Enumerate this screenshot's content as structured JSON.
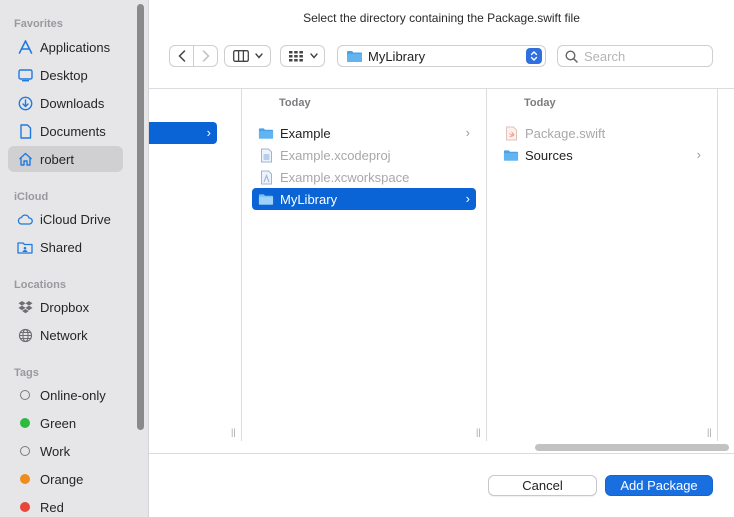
{
  "dialog": {
    "title": "Select the directory containing the Package.swift file"
  },
  "sidebar": {
    "sections": [
      {
        "heading": "Favorites",
        "items": [
          {
            "label": "Applications",
            "icon": "applications-icon"
          },
          {
            "label": "Desktop",
            "icon": "desktop-icon"
          },
          {
            "label": "Downloads",
            "icon": "downloads-icon"
          },
          {
            "label": "Documents",
            "icon": "documents-icon"
          },
          {
            "label": "robert",
            "icon": "home-icon",
            "selected": true
          }
        ]
      },
      {
        "heading": "iCloud",
        "items": [
          {
            "label": "iCloud Drive",
            "icon": "icloud-icon"
          },
          {
            "label": "Shared",
            "icon": "shared-folder-icon"
          }
        ]
      },
      {
        "heading": "Locations",
        "items": [
          {
            "label": "Dropbox",
            "icon": "dropbox-icon"
          },
          {
            "label": "Network",
            "icon": "network-globe-icon"
          }
        ]
      },
      {
        "heading": "Tags",
        "items": [
          {
            "label": "Online-only",
            "color": "hollow"
          },
          {
            "label": "Green",
            "color": "#2dba3e"
          },
          {
            "label": "Work",
            "color": "hollow"
          },
          {
            "label": "Orange",
            "color": "#f08c1c"
          },
          {
            "label": "Red",
            "color": "#e8463a"
          }
        ]
      }
    ]
  },
  "toolbar": {
    "path_label": "MyLibrary",
    "search_placeholder": "Search"
  },
  "columns": [
    {
      "heading": "Today",
      "rows": [
        {
          "label": "Example",
          "type": "folder",
          "chevron": "›"
        },
        {
          "label": "Example.xcodeproj",
          "type": "xcodeproj",
          "disabled": true
        },
        {
          "label": "Example.xcworkspace",
          "type": "xcworkspace",
          "disabled": true
        },
        {
          "label": "MyLibrary",
          "type": "folder",
          "selected": true,
          "chevron": "›"
        }
      ]
    },
    {
      "heading": "Today",
      "rows": [
        {
          "label": "Package.swift",
          "type": "swift",
          "disabled": true
        },
        {
          "label": "Sources",
          "type": "folder",
          "chevron": "›"
        }
      ]
    }
  ],
  "first_column_chevron": "›",
  "resize_glyph": "||",
  "buttons": {
    "cancel": "Cancel",
    "primary": "Add Package"
  },
  "colors": {
    "accent": "#0a64d6",
    "folder": "#4aa3e8"
  }
}
